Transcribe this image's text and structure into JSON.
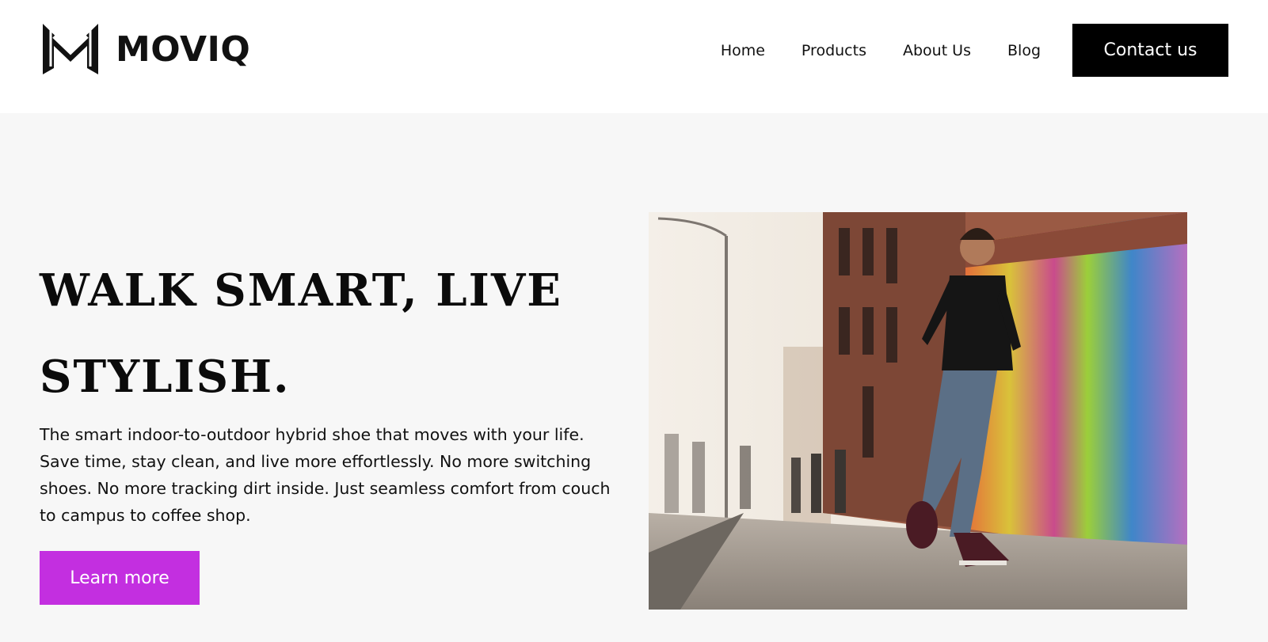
{
  "brand": {
    "name": "MOVIQ",
    "logo_icon": "moviq-m-logo-icon"
  },
  "nav": {
    "links": [
      "Home",
      "Products",
      "About Us",
      "Blog"
    ],
    "cta_label": "Contact us"
  },
  "hero": {
    "title_line1": "WALK SMART, LIVE",
    "title_line2": "STYLISH.",
    "description": "The smart indoor-to-outdoor hybrid shoe that moves with your life. Save time, stay clean, and live more effortlessly. No more switching shoes. No more tracking dirt inside. Just seamless comfort from couch to campus to coffee shop.",
    "button_label": "Learn more",
    "image": "man-walking-on-city-sidewalk-photo"
  },
  "colors": {
    "header_bg": "#ffffff",
    "page_bg": "#f7f7f7",
    "cta_bg": "#000000",
    "accent": "#c32fe0"
  }
}
